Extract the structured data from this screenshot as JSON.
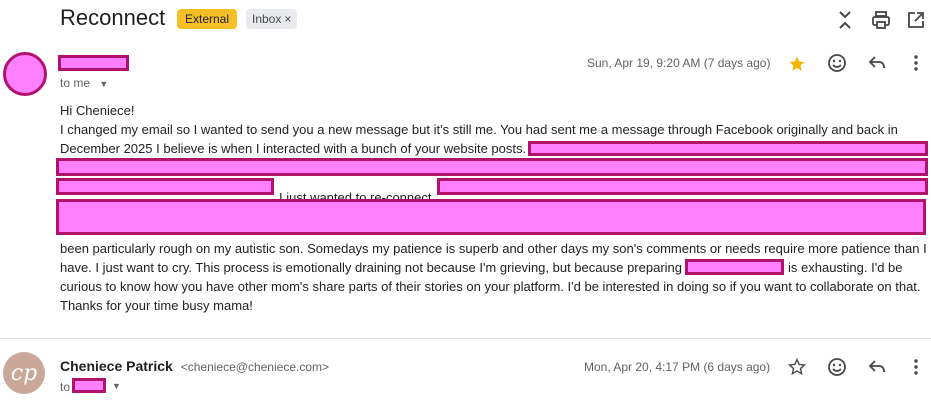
{
  "thread": {
    "subject": "Reconnect",
    "labels": {
      "external": "External",
      "inbox": "Inbox",
      "remove": "×"
    }
  },
  "header_actions": [
    "collapse-all-icon",
    "print-icon",
    "open-in-new-window-icon"
  ],
  "colors": {
    "external_label": "#f6bf26",
    "redaction_fill": "#ff80ff",
    "redaction_border": "#b0126c",
    "star_filled": "#f4b400"
  },
  "message1": {
    "to_label": "to me",
    "date": "Sun, Apr 19, 9:20 AM (7 days ago)",
    "starred": true,
    "greeting": "Hi Cheniece!",
    "line1": "I changed my email so I wanted to send you a new message but it's still me. You had sent me a message through Facebook originally and back in",
    "line2": "December 2025 I believe is when I interacted with a bunch of your website posts.",
    "line4": "I just wanted to re-connect.",
    "line6": "been particularly rough on my autistic son. Somedays my patience is superb and other days my son's comments or needs require more patience than I",
    "line7a": "have. I just want to cry. This process is emotionally draining not because I'm grieving, but because preparing",
    "line7b": "is exhausting. I'd be",
    "line8": "curious to know how you have other mom's share parts of their stories on your platform. I'd be interested in doing so if you want to collaborate on that.",
    "line9": "Thanks for your time busy mama!"
  },
  "message2": {
    "avatar_initials": "cp",
    "sender_name": "Cheniece Patrick",
    "sender_email": "<cheniece@cheniece.com>",
    "to_label": "to",
    "date": "Mon, Apr 20, 4:17 PM (6 days ago)",
    "starred": false
  }
}
